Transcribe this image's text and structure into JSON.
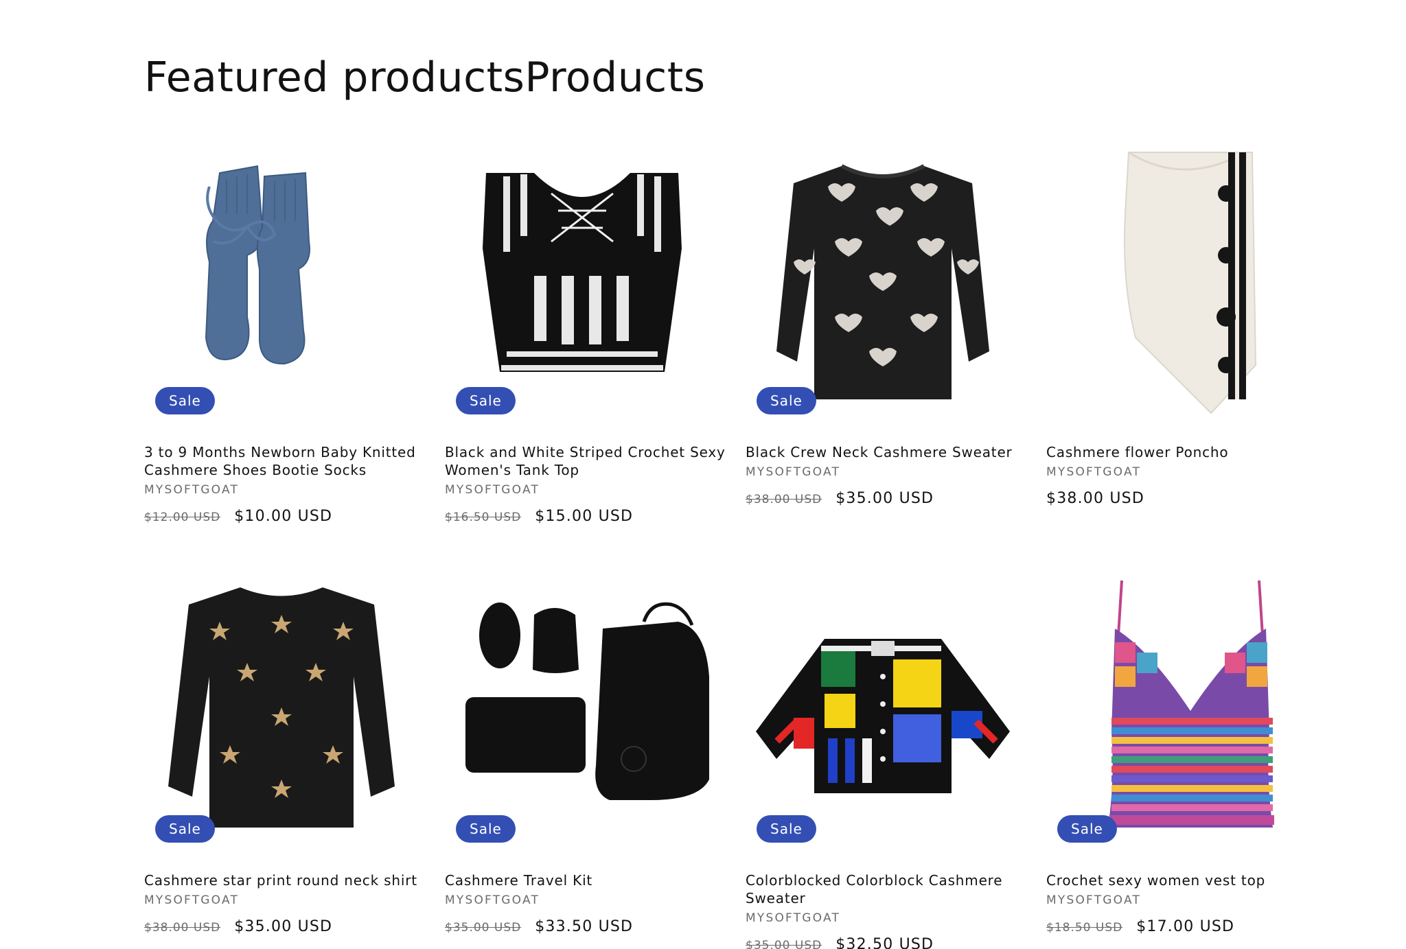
{
  "section": {
    "heading": "Featured productsProducts"
  },
  "products": [
    {
      "title": "3 to 9 Months Newborn Baby Knitted Cashmere Shoes Bootie Socks",
      "vendor": "MYSOFTGOAT",
      "compare_price": "$12.00 USD",
      "price": "$10.00 USD",
      "badge": "Sale",
      "image": "blue-knit-booties"
    },
    {
      "title": "Black and White Striped Crochet Sexy Women's Tank Top",
      "vendor": "MYSOFTGOAT",
      "compare_price": "$16.50 USD",
      "price": "$15.00 USD",
      "badge": "Sale",
      "image": "striped-crochet-top"
    },
    {
      "title": "Black Crew Neck Cashmere Sweater",
      "vendor": "MYSOFTGOAT",
      "compare_price": "$38.00 USD",
      "price": "$35.00 USD",
      "badge": "Sale",
      "image": "black-heart-sweater"
    },
    {
      "title": "Cashmere flower Poncho",
      "vendor": "MYSOFTGOAT",
      "compare_price": "",
      "price": "$38.00 USD",
      "badge": "",
      "image": "white-flower-poncho"
    },
    {
      "title": "Cashmere star print round neck shirt",
      "vendor": "MYSOFTGOAT",
      "compare_price": "$38.00 USD",
      "price": "$35.00 USD",
      "badge": "Sale",
      "image": "black-star-sweater"
    },
    {
      "title": "Cashmere Travel Kit",
      "vendor": "MYSOFTGOAT",
      "compare_price": "$35.00 USD",
      "price": "$33.50 USD",
      "badge": "Sale",
      "image": "black-travel-kit"
    },
    {
      "title": "Colorblocked Colorblock Cashmere Sweater",
      "vendor": "MYSOFTGOAT",
      "compare_price": "$35.00 USD",
      "price": "$32.50 USD",
      "badge": "Sale",
      "image": "colorblock-cardigan"
    },
    {
      "title": "Crochet sexy women vest top",
      "vendor": "MYSOFTGOAT",
      "compare_price": "$18.50 USD",
      "price": "$17.00 USD",
      "badge": "Sale",
      "image": "crochet-vest-top"
    }
  ],
  "colors": {
    "badge": "#334fb4",
    "text": "#121212",
    "muted": "#6b6b6b"
  }
}
